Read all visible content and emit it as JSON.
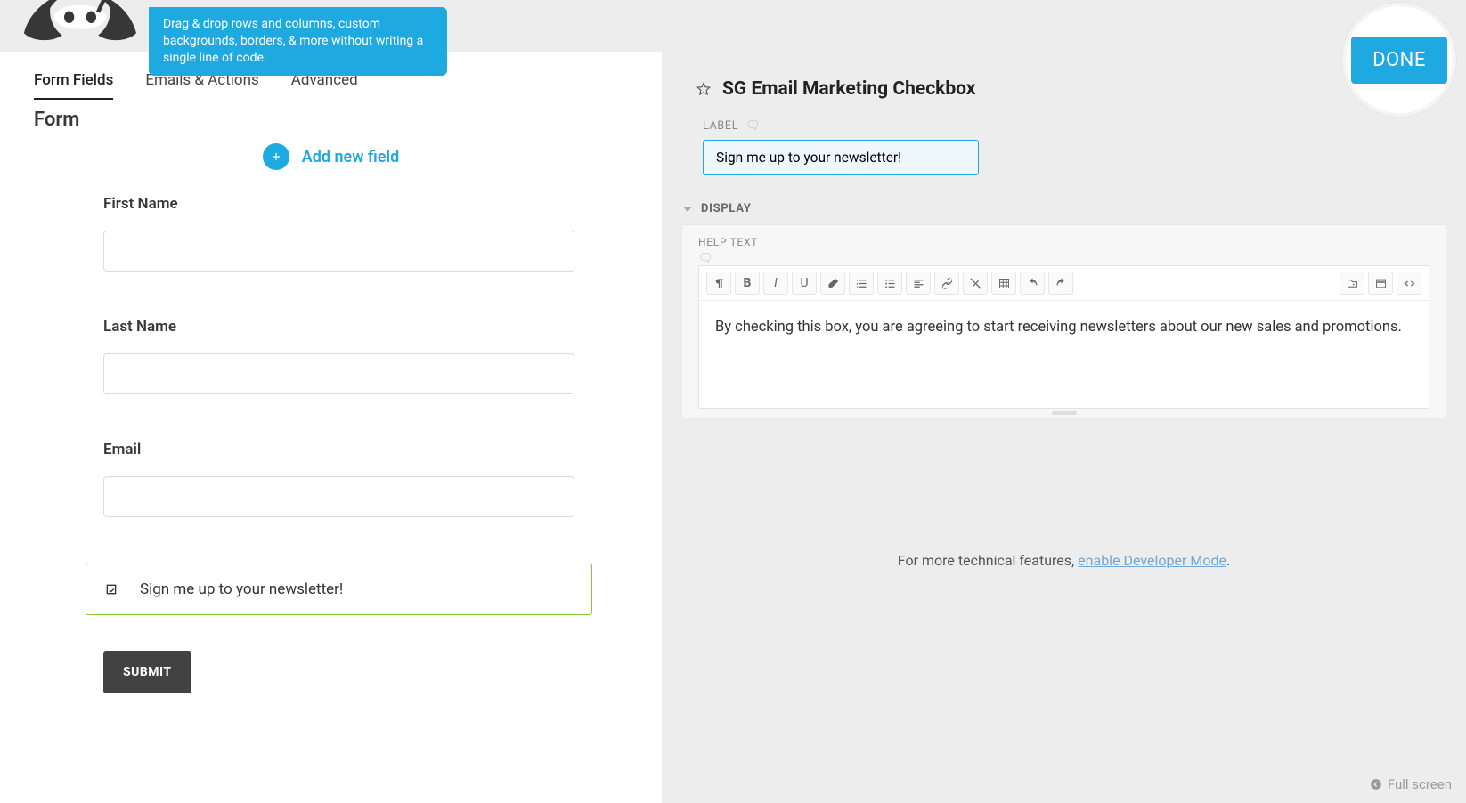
{
  "tooltip_text": "Drag & drop rows and columns, custom backgrounds, borders, & more without writing a single line of code.",
  "done_label": "DONE",
  "tabs": [
    {
      "label": "Form Fields",
      "active": true
    },
    {
      "label": "Emails & Actions",
      "active": false
    },
    {
      "label": "Advanced",
      "active": false
    }
  ],
  "form_title": "Form",
  "add_new_field_label": "Add new field",
  "fields": [
    {
      "label": "First Name",
      "value": ""
    },
    {
      "label": "Last Name",
      "value": ""
    },
    {
      "label": "Email",
      "value": ""
    }
  ],
  "checkbox_field_label": "Sign me up to your newsletter!",
  "submit_label": "SUBMIT",
  "panel": {
    "title": "SG Email Marketing Checkbox",
    "label_heading": "LABEL",
    "label_value": "Sign me up to your newsletter!",
    "display_heading": "DISPLAY",
    "help_text_heading": "HELP TEXT",
    "help_text_body": "By checking this box, you are agreeing to start receiving newsletters about our new sales and promotions."
  },
  "toolbar_icons": [
    "paragraph",
    "bold",
    "italic",
    "underline",
    "eraser",
    "list-ol",
    "list-ul",
    "align",
    "link",
    "unlink",
    "table",
    "undo",
    "redo"
  ],
  "toolbar_right_icons": [
    "merge-tag",
    "fullscreen-editor",
    "code-view"
  ],
  "dev_note_prefix": "For more technical features, ",
  "dev_note_link": "enable Developer Mode",
  "dev_note_suffix": ".",
  "fullscreen_label": "Full screen"
}
